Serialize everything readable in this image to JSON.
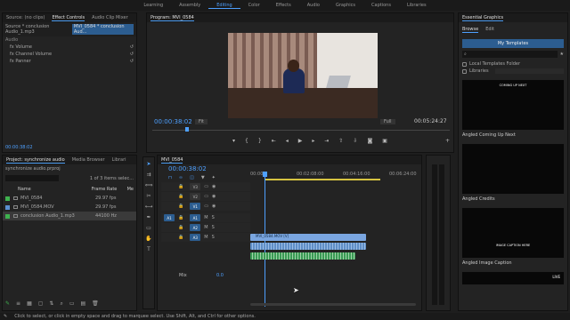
{
  "workspaces": [
    "Learning",
    "Assembly",
    "Editing",
    "Color",
    "Effects",
    "Audio",
    "Graphics",
    "Captions",
    "Libraries"
  ],
  "active_workspace": "Editing",
  "source_panel": {
    "tabs": [
      "Source: (no clips)",
      "Effect Controls",
      "Audio Clip Mixer",
      "MVI_0584"
    ],
    "clip": "Source * conclusion Audio_1.mp3",
    "seq": "MVI_0584 * conclusion Aud...",
    "section": "Audio",
    "props": [
      "Volume",
      "Channel Volume",
      "Panner"
    ],
    "fx": "fx",
    "timecode": "00:00:38:02"
  },
  "program": {
    "title": "Program: MVI_0584",
    "timecode": "00:00:38:02",
    "fit": "Fit",
    "quality": "Full",
    "duration": "00:05:24:27"
  },
  "project": {
    "tabs": [
      "Project: synchronize audio",
      "Media Browser",
      "Librari"
    ],
    "file": "synchronize audio.prproj",
    "count": "1 of 3 items selec...",
    "col_name": "Name",
    "col_rate": "Frame Rate",
    "col_media": "Me",
    "items": [
      {
        "name": "MVI_0584",
        "rate": "29.97 fps",
        "color": "#3fb24f"
      },
      {
        "name": "MVI_0584.MOV",
        "rate": "29.97 fps",
        "color": "#5a8fd0"
      },
      {
        "name": "conclusion Audio_1.mp3",
        "rate": "44100 Hz",
        "color": "#3fb24f"
      }
    ]
  },
  "timeline": {
    "tab": "MVI_0584",
    "timecode": "00:00:38:02",
    "ruler": [
      "00:00",
      "00:02:08:00",
      "00:04:16:00",
      "00:06:24:00"
    ],
    "tracks": [
      "V3",
      "V2",
      "V1",
      "A1",
      "A2",
      "A3"
    ],
    "src_v": "V1",
    "src_a": "A1",
    "mix": "Mix",
    "mix_val": "0.0",
    "clip_v": "MVI_0584.MOV [V]"
  },
  "essential": {
    "title": "Essential Graphics",
    "tabs": [
      "Browse",
      "Edit"
    ],
    "my_templates": "My Templates",
    "local": "Local Templates Folder",
    "libraries": "Libraries",
    "templates": [
      {
        "name": "Angled Coming Up Next",
        "text": "COMING UP NEXT"
      },
      {
        "name": "Angled Credits",
        "text": ""
      },
      {
        "name": "Angled Image Caption",
        "text": "IMAGE CAPTION HERE"
      }
    ],
    "extra": "LIVE"
  },
  "status": "Click to select, or click in empty space and drag to marquee select. Use Shift, Alt, and Ctrl for other options."
}
